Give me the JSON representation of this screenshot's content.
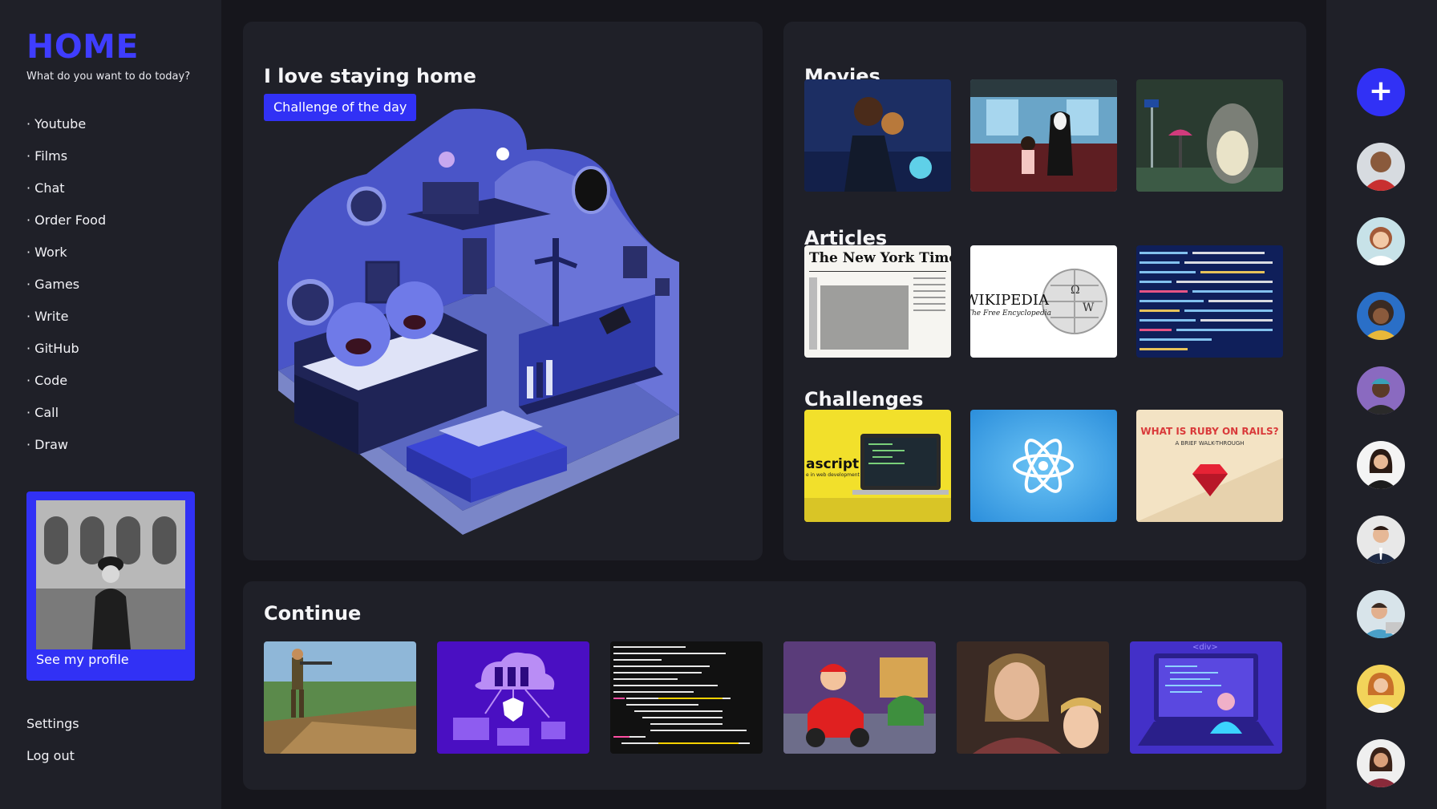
{
  "sidebar": {
    "logo": "HOME",
    "subtitle": "What do you want to do today?",
    "items": [
      {
        "label": "· Youtube"
      },
      {
        "label": "· Films"
      },
      {
        "label": "· Chat"
      },
      {
        "label": "· Order Food"
      },
      {
        "label": "· Work"
      },
      {
        "label": "· Games"
      },
      {
        "label": "· Write"
      },
      {
        "label": "· GitHub"
      },
      {
        "label": "· Code"
      },
      {
        "label": "· Call"
      },
      {
        "label": "· Draw"
      }
    ],
    "profile_label": "See my profile",
    "settings_label": "Settings",
    "logout_label": "Log out"
  },
  "hero": {
    "title": "I love staying home",
    "chip_label": "Challenge of the day"
  },
  "sections": {
    "movies": {
      "title": "Movies"
    },
    "articles": {
      "title": "Articles",
      "nyt": "The New York Times",
      "wiki": "WIKIPEDIA",
      "wiki_sub": "The Free Encyclopedia"
    },
    "challenges": {
      "title": "Challenges",
      "js_text": "ascript",
      "js_sub": "e in web development",
      "ruby_title": "WHAT IS RUBY ON RAILS?",
      "ruby_sub": "A BRIEF WALK-THROUGH"
    }
  },
  "continue": {
    "title": "Continue",
    "code_tag": "<div>"
  },
  "rail": {
    "add_label": "+"
  },
  "colors": {
    "accent": "#3131f5",
    "logo": "#3f3dff",
    "background": "#1f2028",
    "panel": "#1f2028",
    "main": "#16161c"
  }
}
